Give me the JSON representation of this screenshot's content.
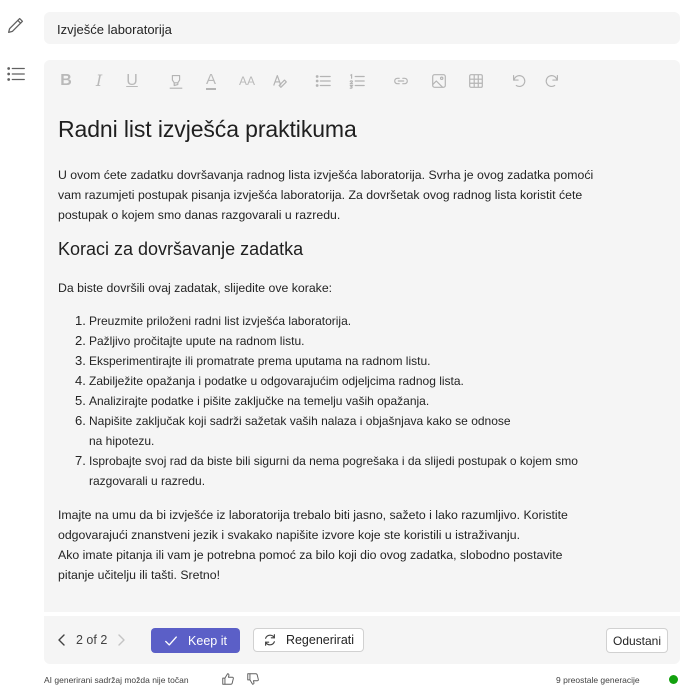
{
  "document_title": "Izvješće laboratorija",
  "toolbar": {
    "bold": "B",
    "italic": "I",
    "underline": "U",
    "font_color": "A",
    "font_size": "AA"
  },
  "content": {
    "heading": "Radni list izvješća praktikuma",
    "intro": "U ovom ćete zadatku dovršavanja radnog lista izvješća laboratorija. Svrha je ovog zadatka pomoći vam razumjeti postupak pisanja izvješća laboratorija. Za dovršetak ovog radnog lista koristit ćete postupak o kojem smo danas razgovarali u razredu.",
    "subheading": "Koraci za dovršavanje zadatka",
    "steps_intro": "Da biste dovršili ovaj zadatak, slijedite ove korake:",
    "steps": [
      {
        "num": "1.",
        "text": "Preuzmite priloženi radni list izvješća laboratorija."
      },
      {
        "num": "2.",
        "text": "Pažljivo pročitajte upute na radnom listu."
      },
      {
        "num": "3.",
        "text": "Eksperimentirajte ili promatrate prema uputama na radnom listu."
      },
      {
        "num": "4.",
        "text": "Zabilježite opažanja i podatke u odgovarajućim odjeljcima radnog lista."
      },
      {
        "num": "5.",
        "text": "Analizirajte podatke i pišite zaključke na temelju vaših opažanja."
      },
      {
        "num": "6.",
        "text": "Napišite zaključak koji sadrži sažetak vaših nalaza i objašnjava kako se odnose na hipotezu."
      },
      {
        "num": "7.",
        "text": "Isprobajte svoj rad da biste bili sigurni da nema pogrešaka i da slijedi postupak o kojem smo razgovarali u razredu."
      }
    ],
    "closing_1": "Imajte na umu da bi izvješće iz laboratorija trebalo biti jasno, sažeto i lako razumljivo. Koristite odgovarajući znanstveni jezik i svakako napišite izvore koje ste koristili u istraživanju.",
    "closing_2": "Ako imate pitanja ili vam je potrebna pomoć za bilo koji dio ovog zadatka, slobodno postavite pitanje učitelju ili tašti. Sretno!"
  },
  "footer": {
    "pager_text": "2 of 2",
    "keep_label": "Keep it",
    "regenerate_label": "Regenerirati",
    "dismiss_label": "Odustani"
  },
  "bottom": {
    "disclaimer": "AI generirani sadržaj možda nije točan",
    "generations_left": "9 preostale generacije",
    "status_color": "#13a10e"
  },
  "colors": {
    "accent": "#5b5fc7",
    "panel_bg": "#f5f5f5",
    "toolbar_disabled": "#b4b4b4"
  }
}
